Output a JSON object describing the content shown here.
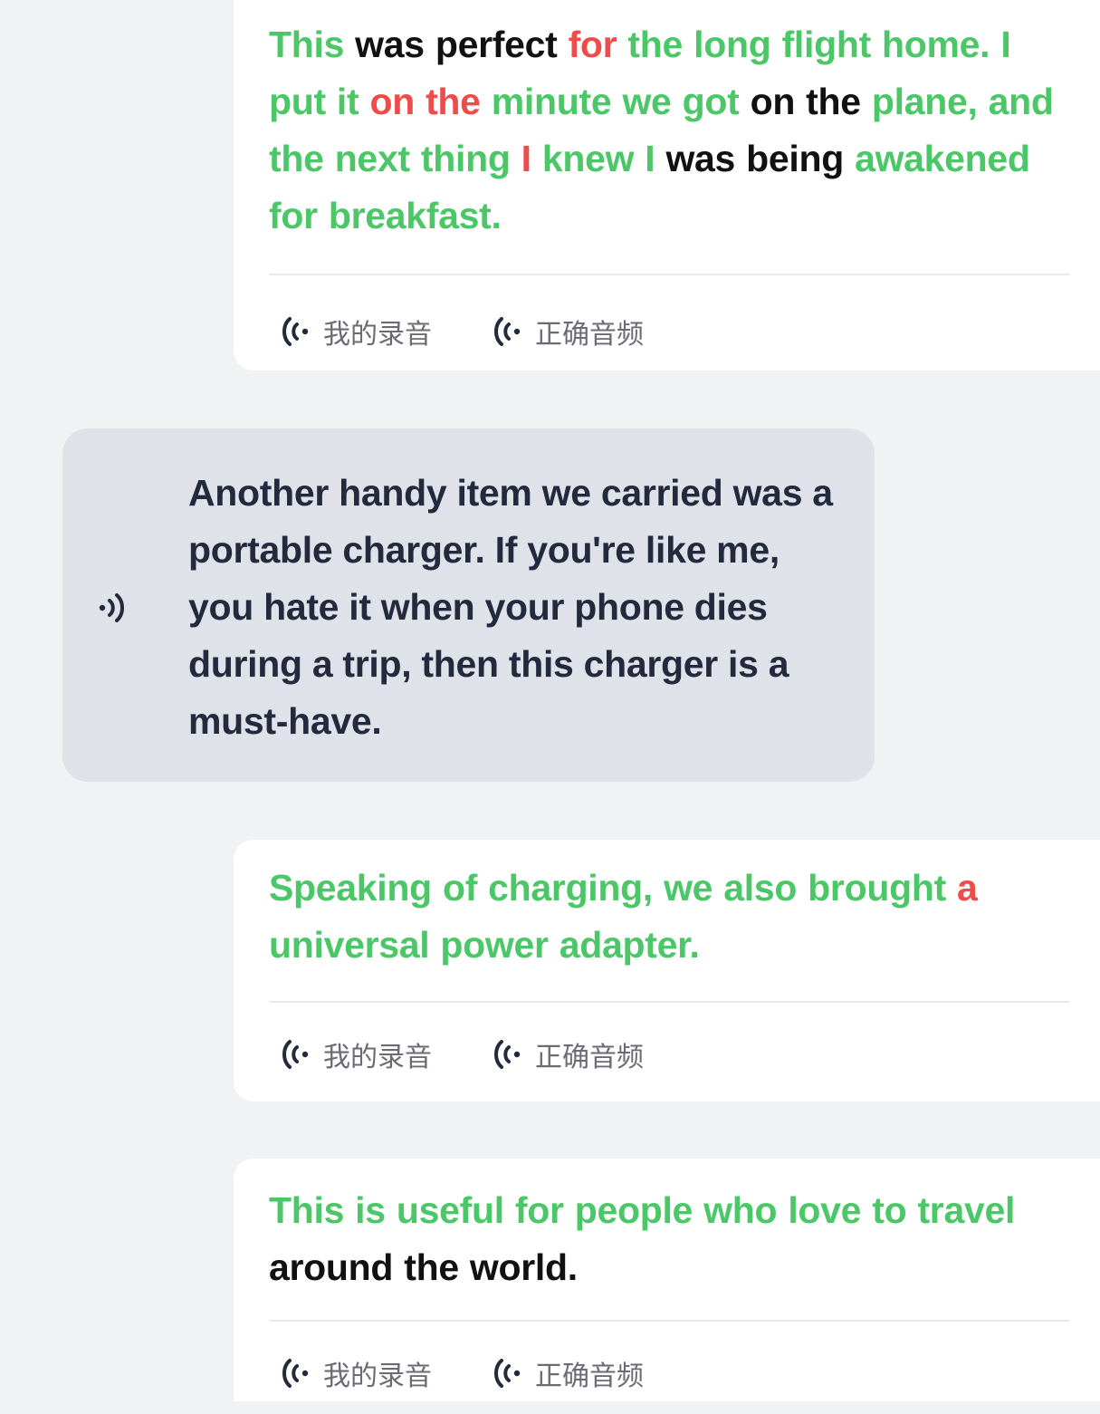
{
  "cards": [
    {
      "segments": [
        {
          "text": "This",
          "status": "green"
        },
        {
          "text": " was perfect ",
          "status": "black"
        },
        {
          "text": "for",
          "status": "red"
        },
        {
          "text": " the long flight home. I put it ",
          "status": "green"
        },
        {
          "text": "on the",
          "status": "red"
        },
        {
          "text": " minute we got ",
          "status": "green"
        },
        {
          "text": "on the ",
          "status": "black"
        },
        {
          "text": "plane, and the next thing ",
          "status": "green"
        },
        {
          "text": "I",
          "status": "red"
        },
        {
          "text": " knew I ",
          "status": "green"
        },
        {
          "text": "was being ",
          "status": "black"
        },
        {
          "text": "awakened for breakfast.",
          "status": "green"
        }
      ],
      "my_recording_label": "我的录音",
      "correct_audio_label": "正确音频"
    },
    {
      "segments": [
        {
          "text": "Speaking of charging, we also brought ",
          "status": "green"
        },
        {
          "text": "a",
          "status": "red"
        },
        {
          "text": " universal power adapter.",
          "status": "green"
        }
      ],
      "my_recording_label": "我的录音",
      "correct_audio_label": "正确音频"
    },
    {
      "segments": [
        {
          "text": "This is useful for people who love to travel ",
          "status": "green"
        },
        {
          "text": "around the world.",
          "status": "black"
        }
      ],
      "my_recording_label": "我的录音",
      "correct_audio_label": "正确音频"
    }
  ],
  "prompt": {
    "text": "Another handy item we carried was a portable charger. If you're like me, you hate it when your phone dies during a trip, then this charger is a must-have."
  },
  "colors": {
    "correct": "#4cc767",
    "incorrect": "#ef4b4b",
    "neutral": "#111111",
    "prompt_text": "#232a3e",
    "prompt_bg": "#dfe3e9",
    "page_bg": "#f1f2f4"
  },
  "icons": {
    "audio": "audio-wave-icon",
    "speaker": "speaker-icon"
  }
}
